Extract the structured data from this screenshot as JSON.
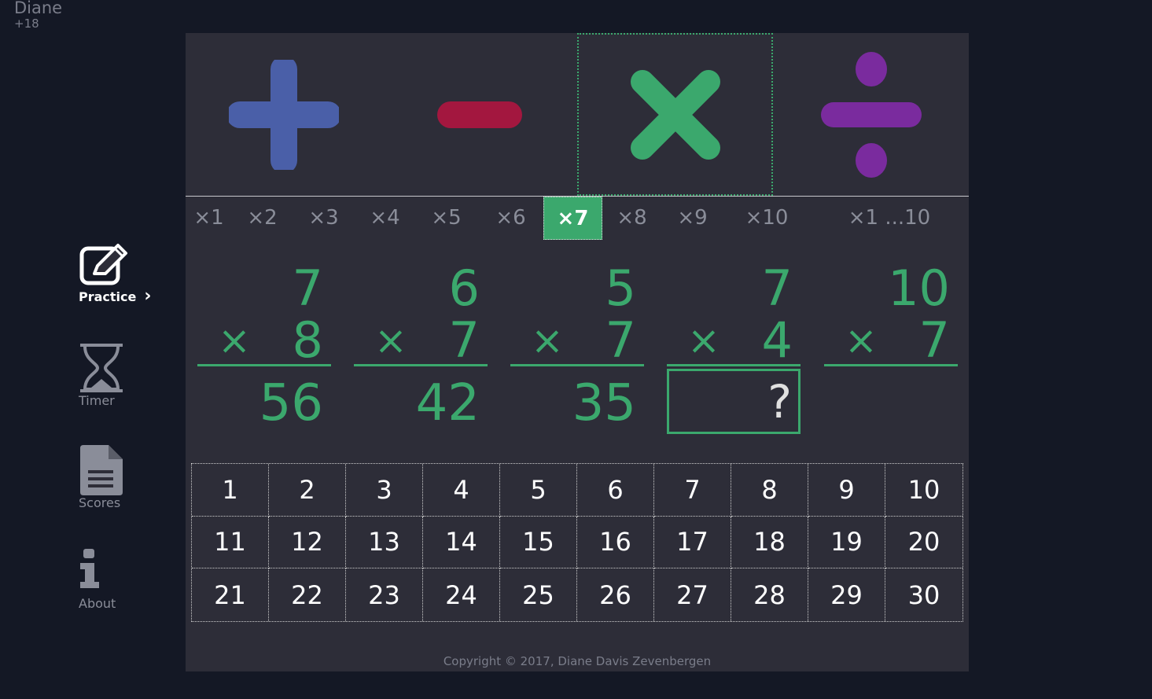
{
  "user": {
    "name": "Diane",
    "score": "+18"
  },
  "nav": [
    {
      "label": "Practice",
      "icon": "edit-icon",
      "active": true
    },
    {
      "label": "Timer",
      "icon": "hourglass-icon",
      "active": false
    },
    {
      "label": "Scores",
      "icon": "document-icon",
      "active": false
    },
    {
      "label": "About",
      "icon": "info-icon",
      "active": false
    }
  ],
  "operations": [
    {
      "name": "plus",
      "color": "#4a5fa8",
      "selected": false
    },
    {
      "name": "minus",
      "color": "#a3173f",
      "selected": false
    },
    {
      "name": "times",
      "color": "#3ba86d",
      "selected": true
    },
    {
      "name": "divide",
      "color": "#7a2b9e",
      "selected": false
    }
  ],
  "tables": [
    "×1",
    "×2",
    "×3",
    "×4",
    "×5",
    "×6",
    "×7",
    "×8",
    "×9",
    "×10",
    "×1 ...10"
  ],
  "active_table": "×7",
  "problems": [
    {
      "a": "7",
      "op": "×",
      "b": "8",
      "answer": "56"
    },
    {
      "a": "6",
      "op": "×",
      "b": "7",
      "answer": "42"
    },
    {
      "a": "5",
      "op": "×",
      "b": "7",
      "answer": "35"
    },
    {
      "a": "7",
      "op": "×",
      "b": "4",
      "answer": "?"
    },
    {
      "a": "10",
      "op": "×",
      "b": "7",
      "answer": ""
    }
  ],
  "keypad": [
    "1",
    "2",
    "3",
    "4",
    "5",
    "6",
    "7",
    "8",
    "9",
    "10",
    "11",
    "12",
    "13",
    "14",
    "15",
    "16",
    "17",
    "18",
    "19",
    "20",
    "21",
    "22",
    "23",
    "24",
    "25",
    "26",
    "27",
    "28",
    "29",
    "30"
  ],
  "copyright": "Copyright © 2017, Diane Davis Zevenbergen",
  "colors": {
    "background": "#141825",
    "panel": "#2d2d38",
    "accent": "#3ba86d"
  }
}
